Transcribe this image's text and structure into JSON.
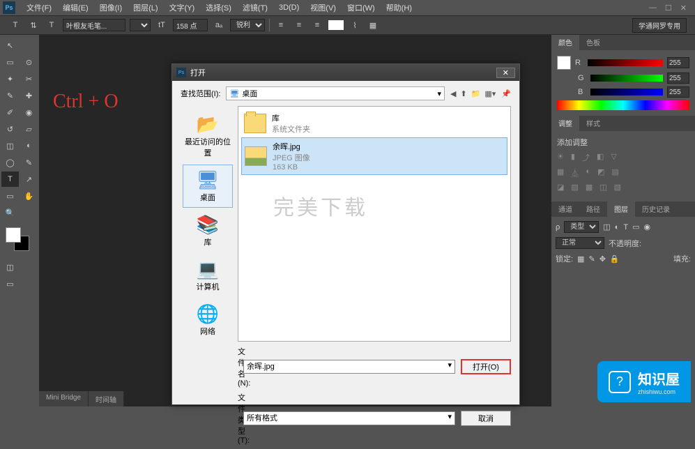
{
  "menubar": {
    "items": [
      "文件(F)",
      "编辑(E)",
      "图像(I)",
      "图层(L)",
      "文字(Y)",
      "选择(S)",
      "滤镜(T)",
      "3D(D)",
      "视图(V)",
      "窗口(W)",
      "帮助(H)"
    ]
  },
  "optbar": {
    "font": "叶根友毛笔...",
    "size": "158 点",
    "aa": "锐利",
    "watermark": "学通网罗专用"
  },
  "canvas": {
    "shortcut": "Ctrl + O"
  },
  "colorPanel": {
    "tabs": [
      "颜色",
      "色板"
    ],
    "r": "255",
    "g": "255",
    "b": "255"
  },
  "adjPanel": {
    "tabs": [
      "调整",
      "样式"
    ],
    "label": "添加调整"
  },
  "layerPanel": {
    "tabs": [
      "通道",
      "路径",
      "图层",
      "历史记录"
    ],
    "kind": "类型",
    "mode": "正常",
    "opacityLabel": "不透明度:",
    "lockLabel": "锁定:",
    "fillLabel": "填充:"
  },
  "status": {
    "tabs": [
      "Mini Bridge",
      "时间轴"
    ]
  },
  "dialog": {
    "title": "打开",
    "lookinLabel": "查找范围(I):",
    "lookinValue": "桌面",
    "places": [
      {
        "label": "最近访问的位置",
        "icon": "recent"
      },
      {
        "label": "桌面",
        "icon": "desktop",
        "active": true
      },
      {
        "label": "库",
        "icon": "library"
      },
      {
        "label": "计算机",
        "icon": "computer"
      },
      {
        "label": "网络",
        "icon": "network"
      }
    ],
    "files": [
      {
        "name": "库",
        "meta": "系统文件夹",
        "type": "folder"
      },
      {
        "name": "余晖.jpg",
        "meta": "JPEG 图像",
        "size": "163 KB",
        "type": "image",
        "selected": true
      }
    ],
    "watermark": "完美下载",
    "filenameLabel": "文件名(N):",
    "filenameValue": "余晖.jpg",
    "filetypeLabel": "文件类型(T):",
    "filetypeValue": "所有格式",
    "openBtn": "打开(O)",
    "cancelBtn": "取消"
  },
  "badge": {
    "title": "知识屋",
    "sub": "zhishiwu.com"
  }
}
